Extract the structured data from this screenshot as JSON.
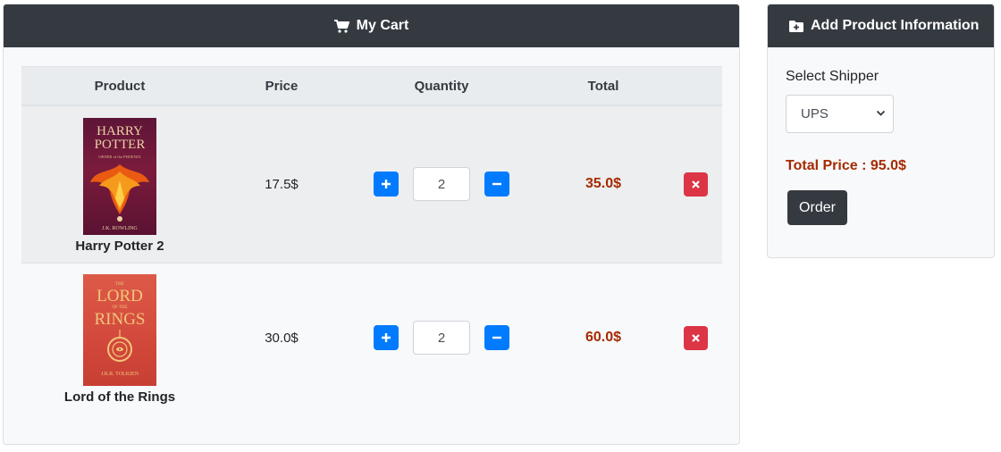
{
  "cart": {
    "title": "My Cart",
    "columns": {
      "product": "Product",
      "price": "Price",
      "quantity": "Quantity",
      "total": "Total"
    },
    "items": [
      {
        "name": "Harry Potter 2",
        "price": "17.5$",
        "quantity": "2",
        "total": "35.0$",
        "cover": {
          "line1": "HARRY",
          "line2": "POTTER",
          "line3": "ORDER of the PHOENIX",
          "author": "J.K. ROWLING"
        }
      },
      {
        "name": "Lord of the Rings",
        "price": "30.0$",
        "quantity": "2",
        "total": "60.0$",
        "cover": {
          "line0": "THE",
          "line1": "LORD",
          "line2": "OF THE",
          "line3": "RINGS",
          "author": "J.R.R. TOLKIEN"
        }
      }
    ]
  },
  "info": {
    "title": "Add Product Information",
    "shipper_label": "Select Shipper",
    "shipper_value": "UPS",
    "total_price": "Total Price : 95.0$",
    "order_label": "Order"
  },
  "colors": {
    "header_bg": "#343a40",
    "primary": "#007bff",
    "danger": "#dc3545",
    "total_text": "#a52a00"
  }
}
